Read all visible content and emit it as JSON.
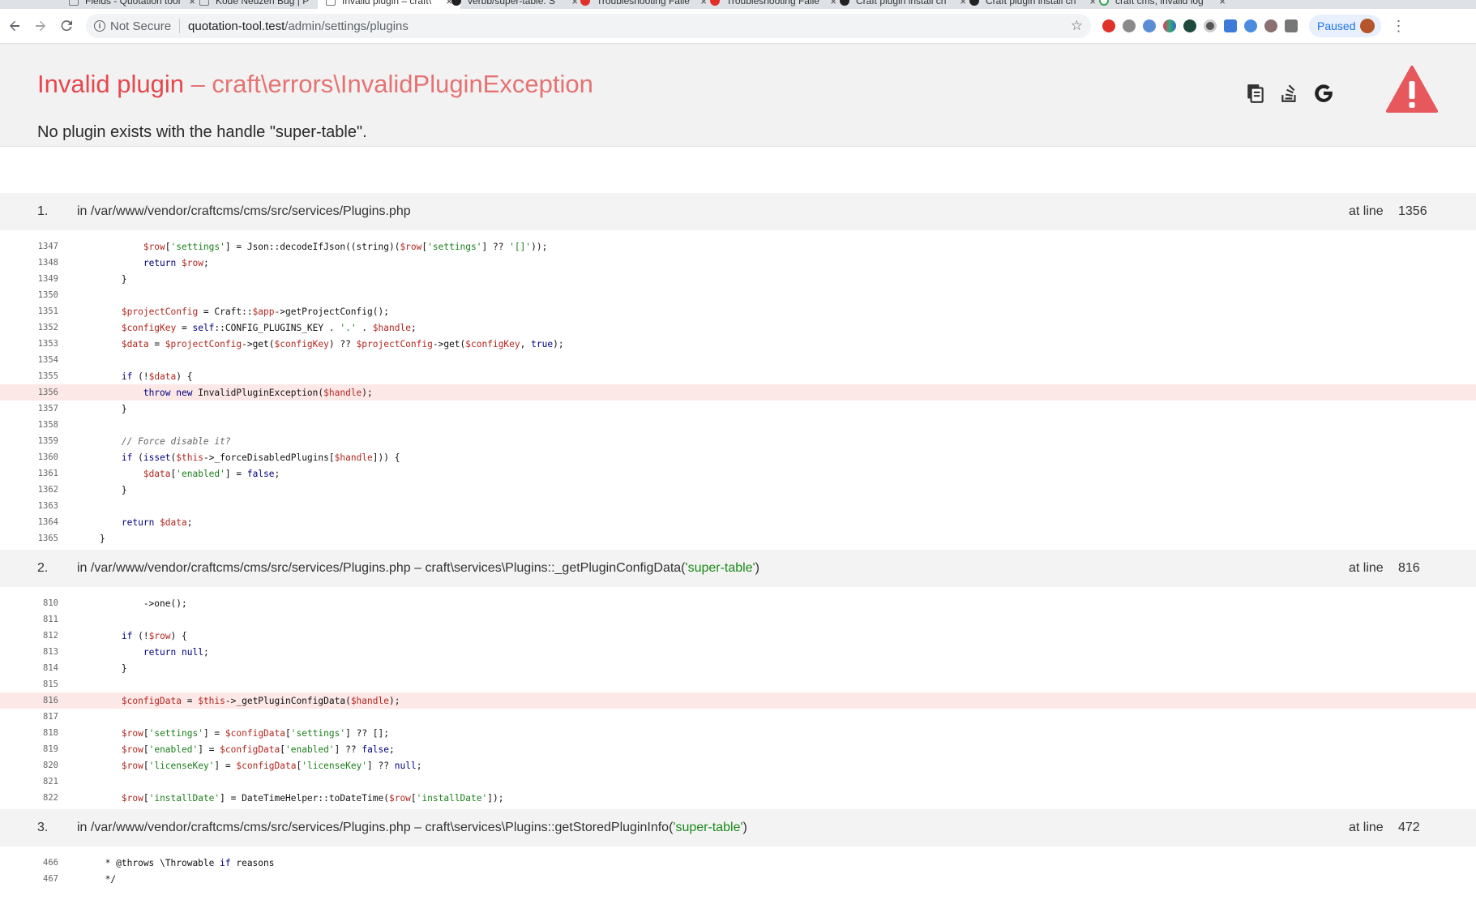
{
  "browser": {
    "tabs": [
      {
        "title": "Fields - Quotation tool",
        "icon": "document-icon"
      },
      {
        "title": "Kode Neuzen Bug | P",
        "icon": "document-icon"
      },
      {
        "title": "Invalid plugin – craft\\",
        "icon": "document-icon",
        "active": true
      },
      {
        "title": "verbb/super-table: S",
        "icon": "github-icon"
      },
      {
        "title": "Troubleshooting Faile",
        "icon": "craft-icon"
      },
      {
        "title": "Troubleshooting Faile",
        "icon": "craft-icon"
      },
      {
        "title": "Craft plugin install ch",
        "icon": "github-icon"
      },
      {
        "title": "Craft plugin install ch",
        "icon": "github-icon"
      },
      {
        "title": "craft cms, invalid log",
        "icon": "google-icon"
      }
    ],
    "security_label": "Not Secure",
    "url_host": "quotation-tool.test",
    "url_path": "/admin/settings/plugins",
    "profile_label": "Paused"
  },
  "error": {
    "title": "Invalid plugin",
    "exception": " – craft\\errors\\InvalidPluginException",
    "message": "No plugin exists with the handle \"super-table\"."
  },
  "colors": {
    "title": "#e6484d",
    "highlight_row": "#fde8e8",
    "warning": "#e6585c"
  },
  "frames": [
    {
      "number": "1.",
      "location": "in /var/www/vendor/craftcms/cms/src/services/Plugins.php",
      "call": "",
      "arg": "",
      "call_end": "",
      "at_line_label": "at line",
      "line": "1356",
      "code": [
        {
          "n": "1347",
          "t": "            $row['settings'] = Json::decodeIfJson((string)($row['settings'] ?? '[]'));"
        },
        {
          "n": "1348",
          "t": "            return $row;"
        },
        {
          "n": "1349",
          "t": "        }"
        },
        {
          "n": "1350",
          "t": ""
        },
        {
          "n": "1351",
          "t": "        $projectConfig = Craft::$app->getProjectConfig();"
        },
        {
          "n": "1352",
          "t": "        $configKey = self::CONFIG_PLUGINS_KEY . '.' . $handle;"
        },
        {
          "n": "1353",
          "t": "        $data = $projectConfig->get($configKey) ?? $projectConfig->get($configKey, true);"
        },
        {
          "n": "1354",
          "t": ""
        },
        {
          "n": "1355",
          "t": "        if (!$data) {"
        },
        {
          "n": "1356",
          "t": "            throw new InvalidPluginException($handle);",
          "hl": true
        },
        {
          "n": "1357",
          "t": "        }"
        },
        {
          "n": "1358",
          "t": ""
        },
        {
          "n": "1359",
          "t": "        // Force disable it?"
        },
        {
          "n": "1360",
          "t": "        if (isset($this->_forceDisabledPlugins[$handle])) {"
        },
        {
          "n": "1361",
          "t": "            $data['enabled'] = false;"
        },
        {
          "n": "1362",
          "t": "        }"
        },
        {
          "n": "1363",
          "t": ""
        },
        {
          "n": "1364",
          "t": "        return $data;"
        },
        {
          "n": "1365",
          "t": "    }"
        }
      ]
    },
    {
      "number": "2.",
      "location": "in /var/www/vendor/craftcms/cms/src/services/Plugins.php",
      "call": " – craft\\services\\Plugins::_getPluginConfigData(",
      "arg": "'super-table'",
      "call_end": ")",
      "at_line_label": "at line",
      "line": "816",
      "code": [
        {
          "n": "810",
          "t": "            ->one();"
        },
        {
          "n": "811",
          "t": ""
        },
        {
          "n": "812",
          "t": "        if (!$row) {"
        },
        {
          "n": "813",
          "t": "            return null;"
        },
        {
          "n": "814",
          "t": "        }"
        },
        {
          "n": "815",
          "t": ""
        },
        {
          "n": "816",
          "t": "        $configData = $this->_getPluginConfigData($handle);",
          "hl": true
        },
        {
          "n": "817",
          "t": ""
        },
        {
          "n": "818",
          "t": "        $row['settings'] = $configData['settings'] ?? [];"
        },
        {
          "n": "819",
          "t": "        $row['enabled'] = $configData['enabled'] ?? false;"
        },
        {
          "n": "820",
          "t": "        $row['licenseKey'] = $configData['licenseKey'] ?? null;"
        },
        {
          "n": "821",
          "t": ""
        },
        {
          "n": "822",
          "t": "        $row['installDate'] = DateTimeHelper::toDateTime($row['installDate']);"
        }
      ]
    },
    {
      "number": "3.",
      "location": "in /var/www/vendor/craftcms/cms/src/services/Plugins.php",
      "call": " – craft\\services\\Plugins::getStoredPluginInfo(",
      "arg": "'super-table'",
      "call_end": ")",
      "at_line_label": "at line",
      "line": "472",
      "code": [
        {
          "n": "466",
          "t": "     * @throws \\Throwable if reasons"
        },
        {
          "n": "467",
          "t": "     */"
        }
      ]
    }
  ]
}
